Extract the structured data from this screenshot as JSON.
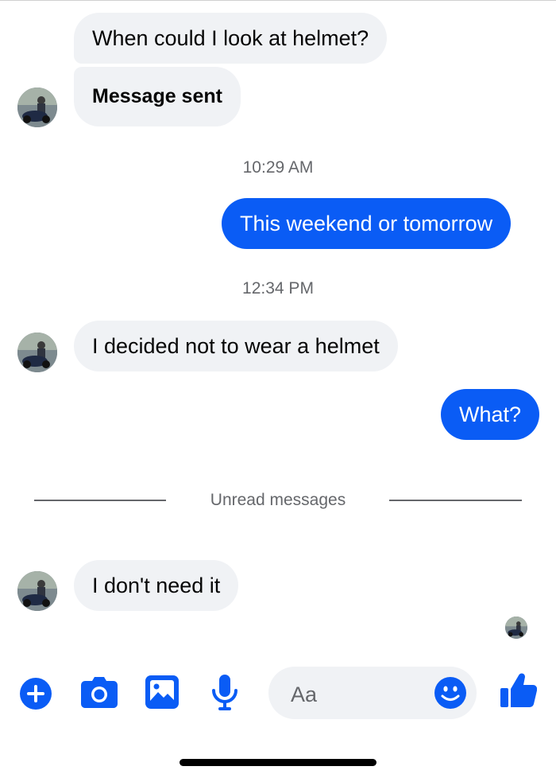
{
  "colors": {
    "accent": "#0a5cf5",
    "incoming_bubble": "#f0f2f5",
    "secondary_text": "#65676b"
  },
  "conversation": {
    "messages": [
      {
        "direction": "incoming",
        "text": "When could I look at helmet?"
      },
      {
        "direction": "incoming",
        "text": "Message sent"
      },
      {
        "direction": "outgoing",
        "text": "This weekend or tomorrow"
      },
      {
        "direction": "incoming",
        "text": "I decided not to wear a helmet"
      },
      {
        "direction": "outgoing",
        "text": "What?"
      },
      {
        "direction": "incoming",
        "text": "I don't need it"
      }
    ],
    "timestamps": [
      "10:29 AM",
      "12:34 PM"
    ],
    "unread_divider": "Unread messages"
  },
  "composer": {
    "placeholder": "Aa",
    "icons": [
      "plus-icon",
      "camera-icon",
      "image-icon",
      "microphone-icon",
      "emoji-icon",
      "thumbs-up-icon"
    ]
  }
}
